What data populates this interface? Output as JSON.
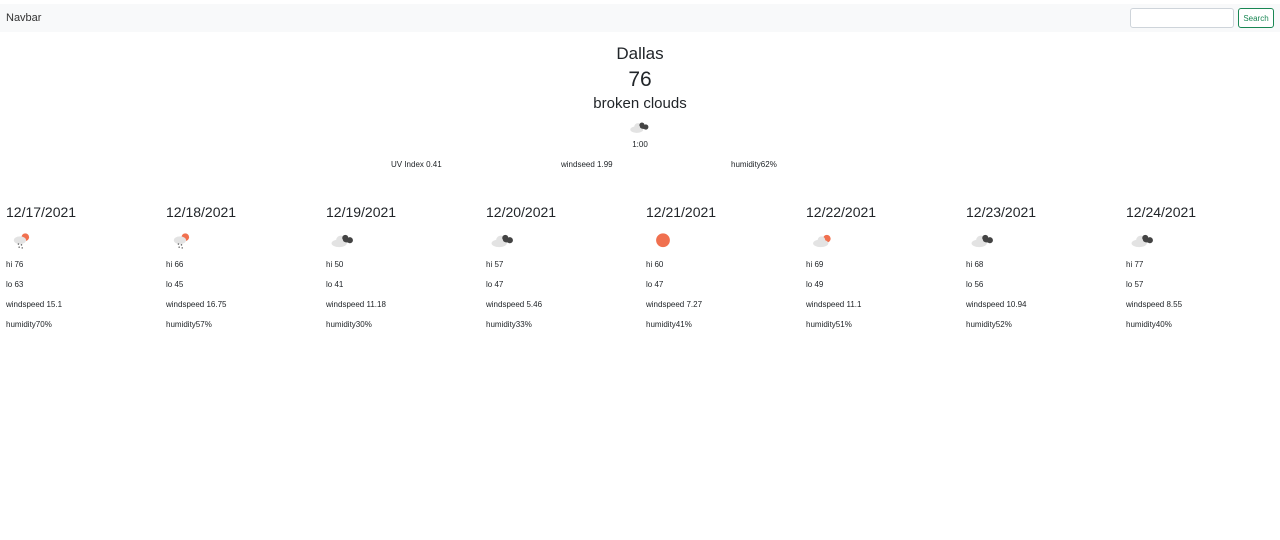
{
  "navbar": {
    "brand": "Navbar",
    "search_placeholder": "",
    "search_button": "Search"
  },
  "current": {
    "city": "Dallas",
    "temp": "76",
    "description": "broken clouds",
    "icon": "broken-clouds-icon",
    "time": "1:00",
    "uv": "UV Index 0.41",
    "wind": "windseed 1.99",
    "humidity": "humidity62%"
  },
  "forecast": [
    {
      "date": "12/17/2021",
      "icon": "rain-sun-icon",
      "hi": "hi 76",
      "lo": "lo 63",
      "wind": "windspeed 15.1",
      "humidity": "humidity70%"
    },
    {
      "date": "12/18/2021",
      "icon": "rain-sun-icon",
      "hi": "hi 66",
      "lo": "lo 45",
      "wind": "windspeed 16.75",
      "humidity": "humidity57%"
    },
    {
      "date": "12/19/2021",
      "icon": "broken-clouds-icon",
      "hi": "hi 50",
      "lo": "lo 41",
      "wind": "windspeed 11.18",
      "humidity": "humidity30%"
    },
    {
      "date": "12/20/2021",
      "icon": "broken-clouds-icon",
      "hi": "hi 57",
      "lo": "lo 47",
      "wind": "windspeed 5.46",
      "humidity": "humidity33%"
    },
    {
      "date": "12/21/2021",
      "icon": "clear-sun-icon",
      "hi": "hi 60",
      "lo": "lo 47",
      "wind": "windspeed 7.27",
      "humidity": "humidity41%"
    },
    {
      "date": "12/22/2021",
      "icon": "partly-cloudy-icon",
      "hi": "hi 69",
      "lo": "lo 49",
      "wind": "windspeed 11.1",
      "humidity": "humidity51%"
    },
    {
      "date": "12/23/2021",
      "icon": "broken-clouds-icon",
      "hi": "hi 68",
      "lo": "lo 56",
      "wind": "windspeed 10.94",
      "humidity": "humidity52%"
    },
    {
      "date": "12/24/2021",
      "icon": "broken-clouds-icon",
      "hi": "hi 77",
      "lo": "lo 57",
      "wind": "windspeed 8.55",
      "humidity": "humidity40%"
    }
  ],
  "colors": {
    "sun": "#f0704f",
    "dark_cloud": "#444444",
    "light_cloud": "#e3e3e3",
    "search_green": "#198754"
  }
}
